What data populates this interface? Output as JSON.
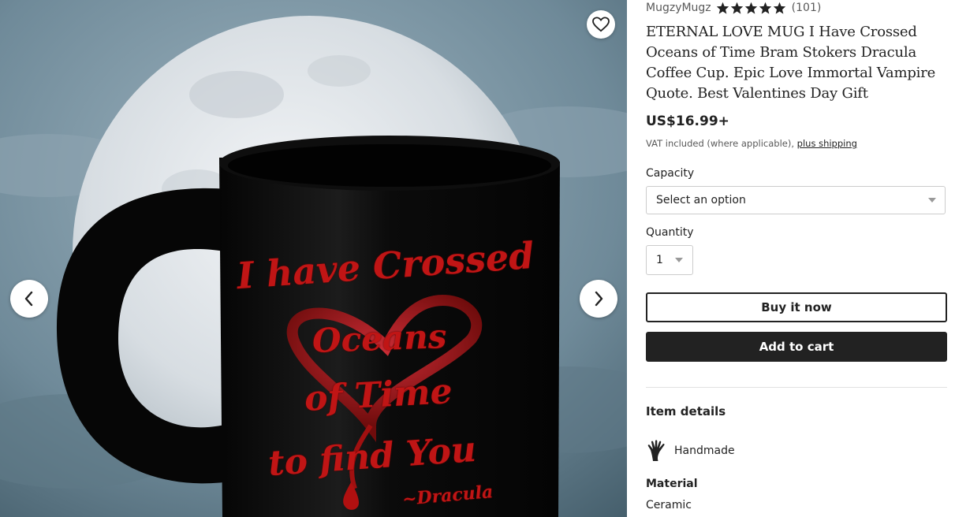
{
  "shop": {
    "name": "MugzyMugz",
    "rating_stars": 5,
    "review_count": "(101)"
  },
  "product": {
    "title": "ETERNAL LOVE MUG I Have Crossed Oceans of Time Bram Stokers Dracula Coffee Cup. Epic Love Immortal Vampire Quote. Best Valentines Day Gift",
    "price": "US$16.99+",
    "vat_text": "VAT included (where applicable), ",
    "shipping_link": "plus shipping"
  },
  "image": {
    "mug_lines": [
      "I have Crossed",
      "Oceans",
      "of Time",
      "to find You",
      "~Dracula"
    ],
    "icons": {
      "favorite": "heart-icon",
      "prev": "chevron-left-icon",
      "next": "chevron-right-icon"
    }
  },
  "options": {
    "capacity_label": "Capacity",
    "capacity_value": "Select an option",
    "quantity_label": "Quantity",
    "quantity_value": "1"
  },
  "actions": {
    "buy_now": "Buy it now",
    "add_to_cart": "Add to cart"
  },
  "item_details": {
    "heading": "Item details",
    "handmade_label": "Handmade",
    "handmade_icon": "hand-icon",
    "material_label": "Material",
    "material_value": "Ceramic"
  },
  "colors": {
    "accent_dark": "#222222",
    "mug_text": "#c01515",
    "sky": "#6f8a99"
  }
}
